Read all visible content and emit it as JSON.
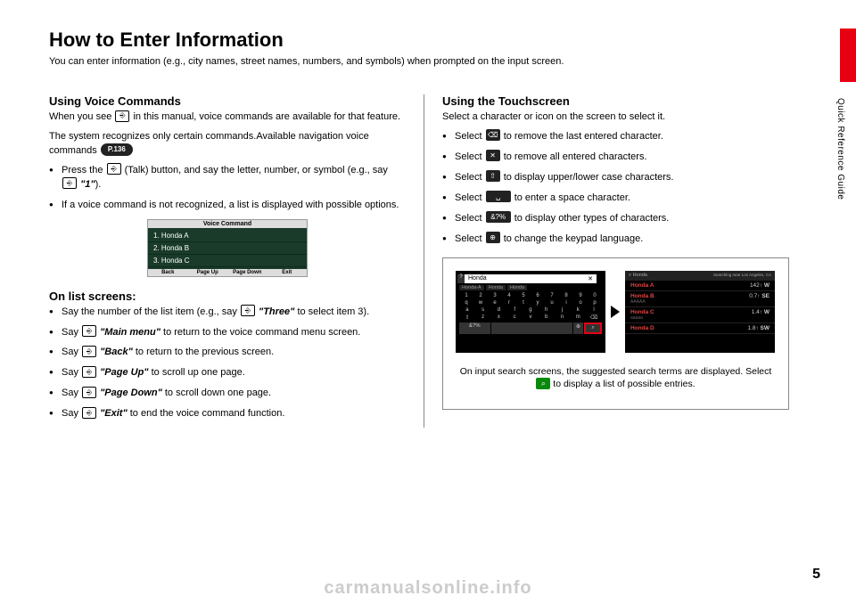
{
  "page": {
    "title": "How to Enter Information",
    "subtitle": "You can enter information (e.g., city names, street names, numbers, and symbols) when prompted on the input screen.",
    "side_label": "Quick Reference Guide",
    "page_number": "5",
    "watermark": "carmanualsonline.info"
  },
  "left": {
    "voice_heading": "Using Voice Commands",
    "voice_intro": "When you see ",
    "voice_intro2": " in this manual, voice commands are available for that feature.",
    "voice_p2_a": "The system recognizes only certain commands.Available navigation voice commands ",
    "voice_ref": "P.136",
    "bullets1": [
      {
        "pre": "Press the ",
        "mid": " (Talk) button, and say the letter, number, or symbol (e.g., say ",
        "cmd": "\"1\"",
        "post": ")."
      },
      {
        "text": "If a voice command is not recognized, a list is displayed with possible options."
      }
    ],
    "vc_shot": {
      "title": "Voice Command",
      "rows": [
        "1. Honda A",
        "2. Honda B",
        "3. Honda C"
      ],
      "footer": [
        "Back",
        "Page Up",
        "Page Down",
        "Exit"
      ]
    },
    "list_heading": "On list screens:",
    "bullets2": [
      {
        "pre": "Say the number of the list item (e.g., say ",
        "cmd": "\"Three\"",
        "post": " to select item 3)."
      },
      {
        "pre": "Say ",
        "cmd": "\"Main menu\"",
        "post": " to return to the voice command menu screen."
      },
      {
        "pre": "Say ",
        "cmd": "\"Back\"",
        "post": " to return to the previous screen."
      },
      {
        "pre": "Say ",
        "cmd": "\"Page Up\"",
        "post": " to scroll up one page."
      },
      {
        "pre": "Say ",
        "cmd": "\"Page Down\"",
        "post": " to scroll down one page."
      },
      {
        "pre": "Say ",
        "cmd": "\"Exit\"",
        "post": " to end the voice command function."
      }
    ]
  },
  "right": {
    "heading": "Using the Touchscreen",
    "intro": "Select a character or icon on the screen to select it.",
    "bullets": [
      {
        "pre": "Select ",
        "icon": "backspace",
        "post": " to remove the last entered character."
      },
      {
        "pre": "Select ",
        "icon": "clear",
        "post": " to remove all entered characters."
      },
      {
        "pre": "Select ",
        "icon": "shift",
        "post": " to display upper/lower case characters."
      },
      {
        "pre": "Select ",
        "icon": "space",
        "post": " to enter a space character."
      },
      {
        "pre": "Select ",
        "icon": "symbols",
        "post": " to display other types of characters."
      },
      {
        "pre": "Select ",
        "icon": "globe",
        "post": " to change the keypad language."
      }
    ],
    "kbd_screen": {
      "input_text": "Honda",
      "suggestions": [
        "Honda-A",
        "Honda",
        "Honda"
      ],
      "row_nums": [
        "1",
        "2",
        "3",
        "4",
        "5",
        "6",
        "7",
        "8",
        "9",
        "0"
      ],
      "row_q": [
        "q",
        "w",
        "e",
        "r",
        "t",
        "y",
        "u",
        "i",
        "o",
        "p"
      ],
      "row_a": [
        "a",
        "s",
        "d",
        "f",
        "g",
        "h",
        "j",
        "k",
        "l"
      ],
      "row_z": [
        "z",
        "x",
        "c",
        "v",
        "b",
        "n",
        "m"
      ]
    },
    "result_screen": {
      "header_left": "⌕ Honda",
      "header_right": "Searching near Los Angeles, CA",
      "rows": [
        {
          "name": "Honda A",
          "sub": "",
          "dist": "142↑",
          "dir": "W"
        },
        {
          "name": "Honda B",
          "sub": "AAAAA",
          "dist": "0.7↑",
          "dir": "SE"
        },
        {
          "name": "Honda C",
          "sub": "aaaaa",
          "dist": "1.4↑",
          "dir": "W"
        },
        {
          "name": "Honda D",
          "sub": "",
          "dist": "1.8↑",
          "dir": "SW"
        }
      ]
    },
    "caption_a": "On input search screens, the suggested search terms are displayed. Select ",
    "caption_b": " to display a list of possible entries."
  },
  "icons": {
    "talk": "⎆",
    "backspace": "⌫",
    "clear": "✕",
    "shift": "⇧",
    "space": "␣",
    "symbols": "&?%",
    "globe": "⊕",
    "search": "⌕"
  }
}
